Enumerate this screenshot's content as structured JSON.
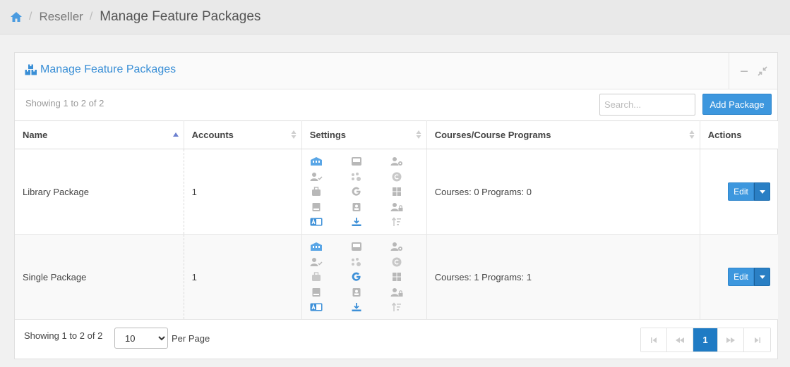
{
  "breadcrumb": {
    "home_icon": "home-icon",
    "separator": "/",
    "items": [
      "Reseller"
    ],
    "current": "Manage Feature Packages"
  },
  "panel": {
    "title": "Manage Feature Packages",
    "title_icon": "boxes-icon",
    "tools": [
      "minimize-icon",
      "collapse-icon"
    ]
  },
  "toolbar": {
    "showing": "Showing 1 to 2 of 2",
    "search_placeholder": "Search...",
    "add_label": "Add Package"
  },
  "table": {
    "columns": [
      "Name",
      "Accounts",
      "Settings",
      "Courses/Course Programs",
      "Actions"
    ],
    "rows": [
      {
        "name": "Library Package",
        "accounts": "1",
        "courses": "Courses: 0 Programs: 0",
        "action": "Edit"
      },
      {
        "name": "Single Package",
        "accounts": "1",
        "courses": "Courses: 1 Programs: 1",
        "action": "Edit"
      }
    ]
  },
  "footer": {
    "showing": "Showing 1 to 2 of 2",
    "per_page_value": "10",
    "per_page_options": [
      "10"
    ],
    "per_page_label": "Per Page",
    "current_page": "1"
  },
  "colors": {
    "accent": "#3d97de",
    "active_page": "#1f7bc4",
    "icon_gray": "#b8b8b8"
  }
}
